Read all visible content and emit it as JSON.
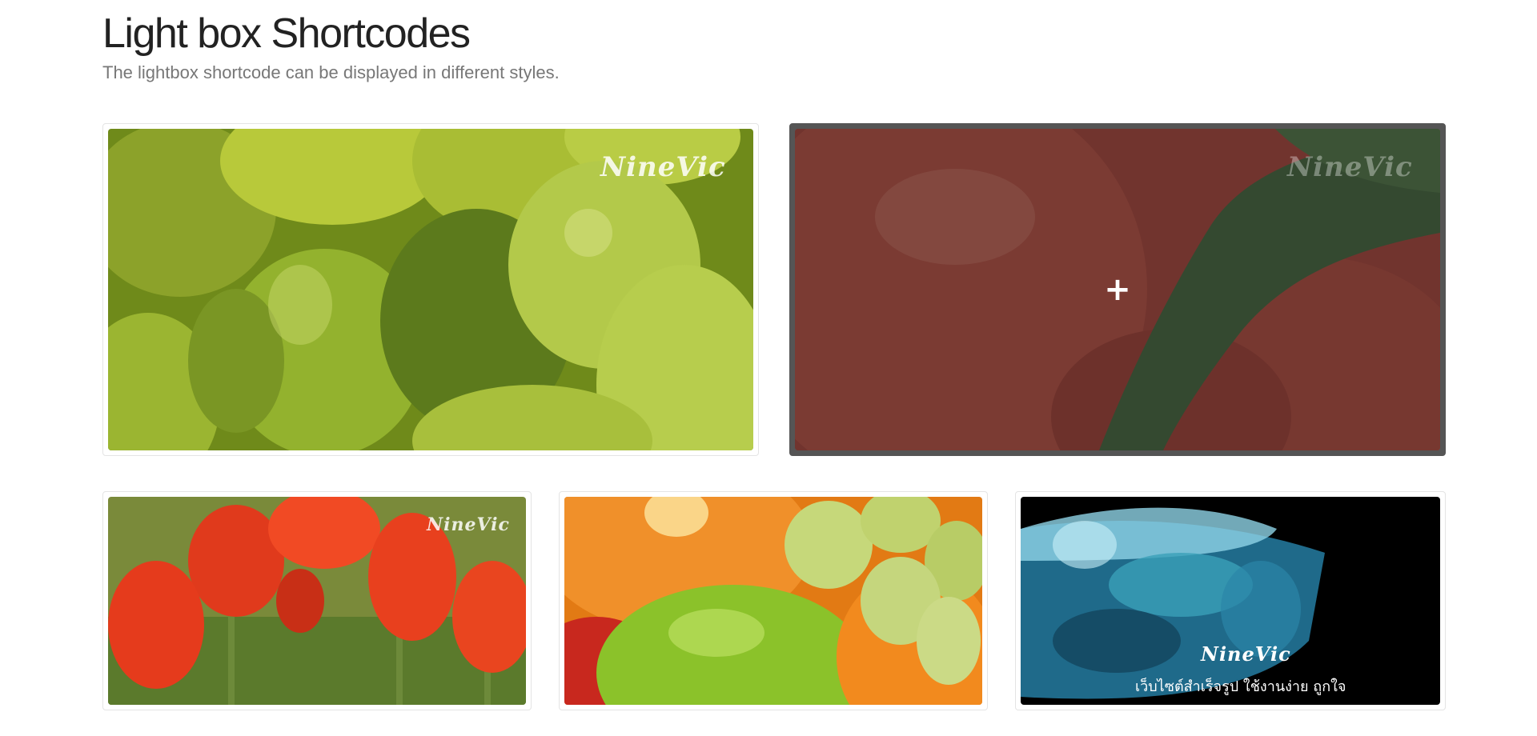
{
  "header": {
    "title": "Light box Shortcodes",
    "subtitle": "The lightbox shortcode can be displayed in different styles."
  },
  "lightbox_items": [
    {
      "subject": "grapes",
      "watermark": "NineVic"
    },
    {
      "subject": "tomato",
      "watermark": "NineVic",
      "hovered": true,
      "overlay_icon": "plus-icon"
    },
    {
      "subject": "tulips",
      "watermark": "NineVic"
    },
    {
      "subject": "fruits",
      "watermark": ""
    },
    {
      "subject": "water",
      "watermark": "NineVic",
      "tagline": "เว็บไซต์สำเร็จรูป ใช้งานง่าย ถูกใจ"
    }
  ],
  "colors": {
    "overlay": "#555555",
    "border": "#e4e4e4",
    "title": "#222222",
    "subtitle": "#777777"
  }
}
